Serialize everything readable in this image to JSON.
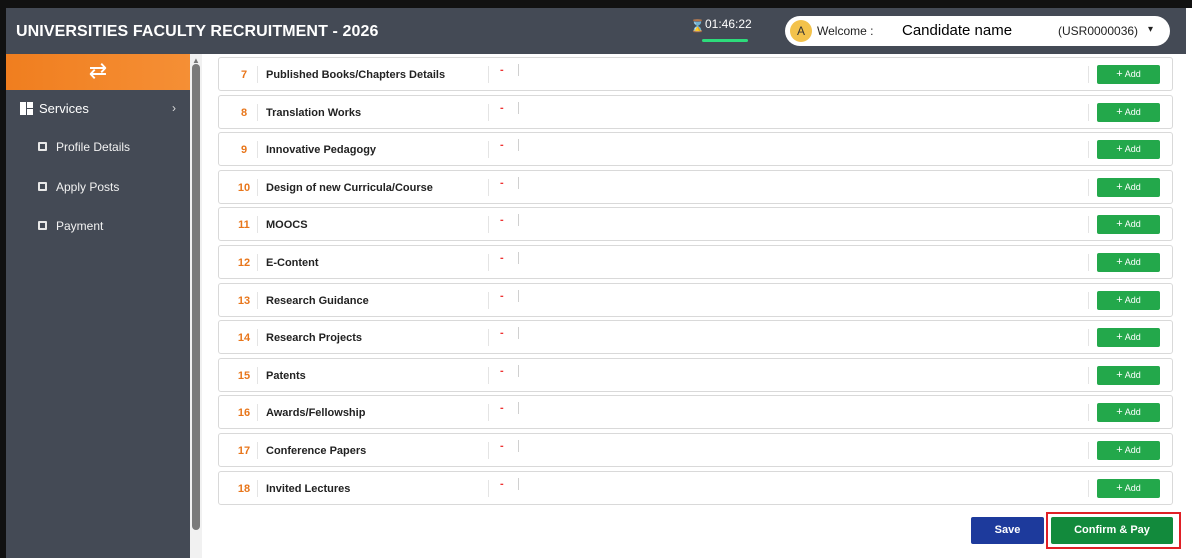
{
  "header": {
    "title": "UNIVERSITIES FACULTY RECRUITMENT - 2026",
    "timer": "01:46:22",
    "avatar_letter": "A",
    "welcome_label": "Welcome :",
    "candidate_name": "Candidate name",
    "user_id": "(USR0000036)",
    "caret": "▾"
  },
  "sidebar": {
    "toggle_icon": "⇄",
    "services_label": "Services",
    "services_chevron": "›",
    "items": [
      {
        "label": "Profile Details"
      },
      {
        "label": "Apply Posts"
      },
      {
        "label": "Payment"
      }
    ]
  },
  "rows": [
    {
      "num": "7",
      "title": "Published Books/Chapters Details",
      "value": "-",
      "add_label": "Add"
    },
    {
      "num": "8",
      "title": "Translation Works",
      "value": "-",
      "add_label": "Add"
    },
    {
      "num": "9",
      "title": "Innovative Pedagogy",
      "value": "-",
      "add_label": "Add"
    },
    {
      "num": "10",
      "title": "Design of new Curricula/Course",
      "value": "-",
      "add_label": "Add"
    },
    {
      "num": "11",
      "title": "MOOCS",
      "value": "-",
      "add_label": "Add"
    },
    {
      "num": "12",
      "title": "E-Content",
      "value": "-",
      "add_label": "Add"
    },
    {
      "num": "13",
      "title": "Research Guidance",
      "value": "-",
      "add_label": "Add"
    },
    {
      "num": "14",
      "title": "Research Projects",
      "value": "-",
      "add_label": "Add"
    },
    {
      "num": "15",
      "title": "Patents",
      "value": "-",
      "add_label": "Add"
    },
    {
      "num": "16",
      "title": "Awards/Fellowship",
      "value": "-",
      "add_label": "Add"
    },
    {
      "num": "17",
      "title": "Conference Papers",
      "value": "-",
      "add_label": "Add"
    },
    {
      "num": "18",
      "title": "Invited Lectures",
      "value": "-",
      "add_label": "Add"
    }
  ],
  "footer": {
    "save_label": "Save",
    "confirm_label": "Confirm & Pay"
  },
  "colors": {
    "header_bg": "#444a55",
    "accent_orange": "#f07e1f",
    "add_green": "#23a84b",
    "save_blue": "#1d3a9c",
    "confirm_green": "#128a3c",
    "highlight_red": "#e01f26"
  }
}
